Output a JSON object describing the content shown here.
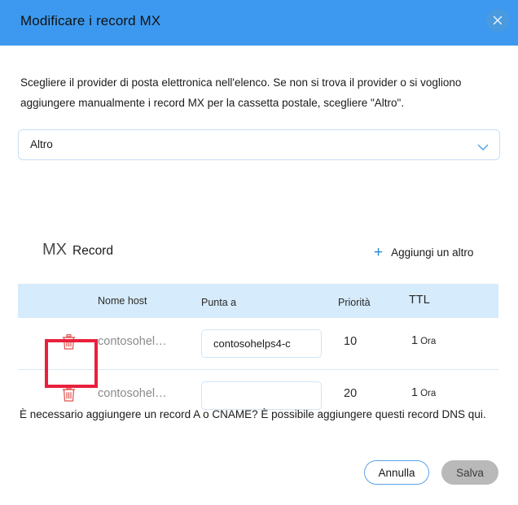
{
  "dialog": {
    "title": "Modificare i record MX",
    "close_icon": "close-icon"
  },
  "intro": {
    "text": "Scegliere il provider di posta elettronica nell'elenco. Se non si trova il provider o si vogliono aggiungere manualmente i record MX per la cassetta postale, scegliere \"Altro\"."
  },
  "provider_select": {
    "value": "Altro",
    "chevron_icon": "chevron-down-icon"
  },
  "section": {
    "title_primary": "MX",
    "title_secondary": "Record",
    "add_another_plus": "+",
    "add_another_label": "Aggiungi un altro"
  },
  "table": {
    "columns": {
      "host": "Nome host",
      "points_to": "Punta a",
      "priority": "Priorità",
      "ttl": "TTL"
    },
    "rows": [
      {
        "delete_icon": "trash-icon",
        "host": "contosohel…",
        "points_to_value": "contosohelps4-c",
        "points_to_placeholder": "",
        "priority": "10",
        "ttl_number": "1",
        "ttl_unit": "Ora"
      },
      {
        "delete_icon": "trash-icon",
        "host": "contosohel…",
        "points_to_value": "",
        "points_to_placeholder": "",
        "priority": "20",
        "ttl_number": "1",
        "ttl_unit": "Ora"
      }
    ]
  },
  "footer": {
    "note": "È necessario aggiungere un record A o CNAME? È possibile aggiungere questi record DNS qui.",
    "cancel_label": "Annulla",
    "save_label": "Salva"
  },
  "colors": {
    "header_blue": "#3c99ef",
    "table_header_blue": "#d6ebfb",
    "accent_blue": "#2b88d8",
    "trash_red": "#e0514d",
    "annotation_red": "#e8203c",
    "save_disabled_gray": "#b9b9b9"
  }
}
